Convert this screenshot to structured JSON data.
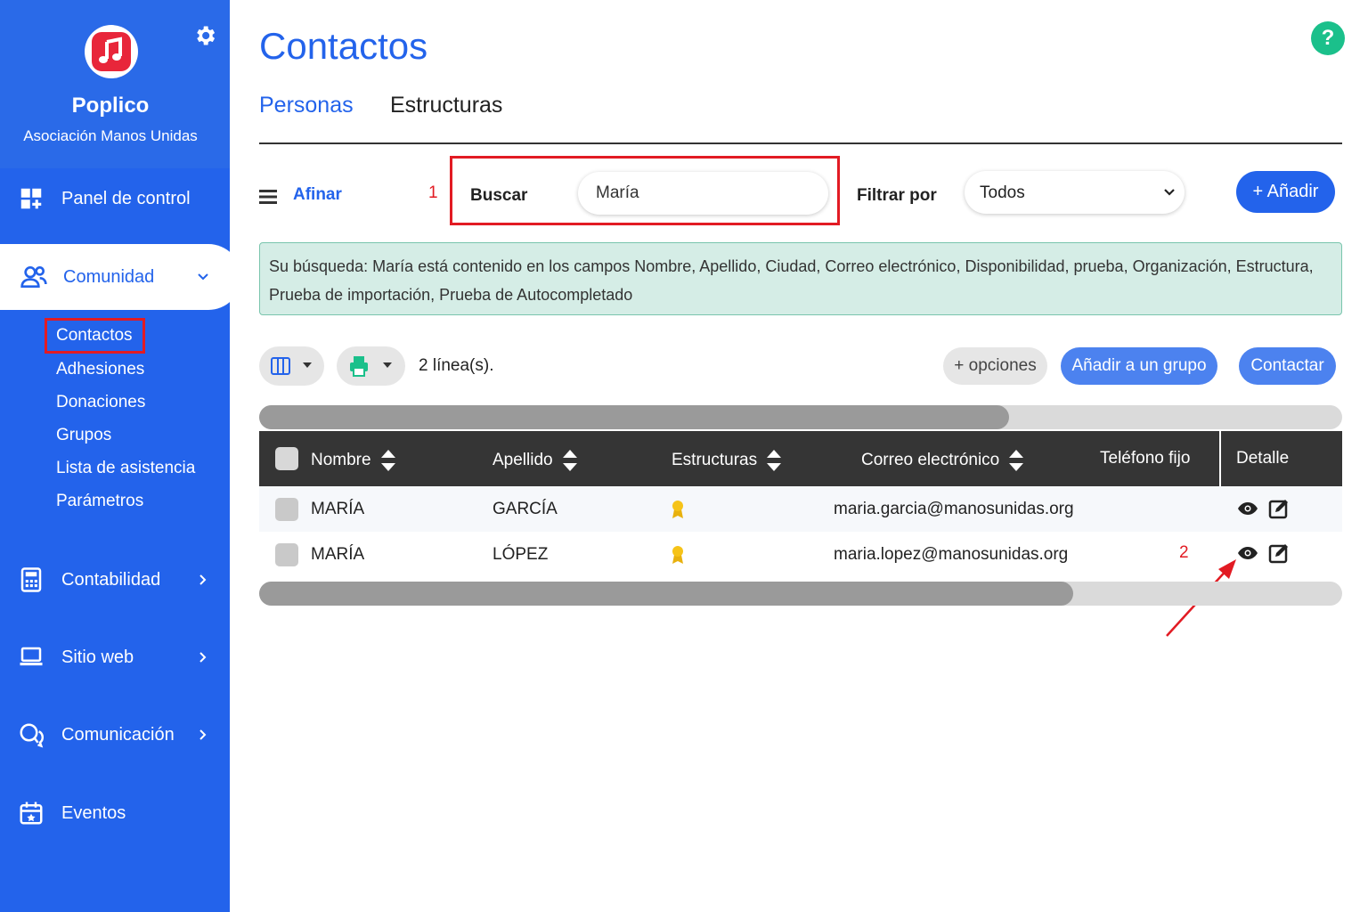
{
  "sidebar": {
    "app_name": "Poplico",
    "org_name": "Asociación Manos Unidas",
    "items": [
      {
        "label": "Panel de control"
      },
      {
        "label": "Comunidad"
      },
      {
        "label": "Contabilidad"
      },
      {
        "label": "Sitio web"
      },
      {
        "label": "Comunicación"
      },
      {
        "label": "Eventos"
      }
    ],
    "subitems": [
      {
        "label": "Contactos"
      },
      {
        "label": "Adhesiones"
      },
      {
        "label": "Donaciones"
      },
      {
        "label": "Grupos"
      },
      {
        "label": "Lista de asistencia"
      },
      {
        "label": "Parámetros"
      }
    ]
  },
  "header": {
    "title": "Contactos",
    "help": "?",
    "tabs": [
      {
        "label": "Personas"
      },
      {
        "label": "Estructuras"
      }
    ]
  },
  "toolbar": {
    "afinar": "Afinar",
    "annotation_1": "1",
    "search_label": "Buscar",
    "search_value": "María",
    "filter_label": "Filtrar por",
    "filter_value": "Todos",
    "add_label": "+ Añadir"
  },
  "info": {
    "text": "Su búsqueda: María está contenido en los campos Nombre, Apellido, Ciudad, Correo electrónico, Disponibilidad, prueba, Organización, Estructura, Prueba de importación, Prueba de Autocompletado"
  },
  "actions": {
    "lines": "2 línea(s).",
    "options": "+ opciones",
    "add_group": "Añadir a un grupo",
    "contact": "Contactar"
  },
  "table": {
    "columns": [
      "Nombre",
      "Apellido",
      "Estructuras",
      "Correo electrónico",
      "Teléfono fijo",
      "Detalle"
    ],
    "rows": [
      {
        "nombre": "MARÍA",
        "apellido": "GARCÍA",
        "correo": "maria.garcia@manosunidas.org",
        "telefono": ""
      },
      {
        "nombre": "MARÍA",
        "apellido": "LÓPEZ",
        "correo": "maria.lopez@manosunidas.org",
        "telefono": ""
      }
    ],
    "annotation_2": "2"
  },
  "colors": {
    "primary": "#2363eb",
    "accent_red": "#e21b23",
    "help_green": "#1bc08b",
    "info_bg": "#d5ede6",
    "header_dark": "#353535"
  },
  "icons": [
    "gear-icon",
    "dashboard-icon",
    "users-icon",
    "calculator-icon",
    "laptop-icon",
    "chat-icon",
    "calendar-icon",
    "menu-icon",
    "chevron-down-icon",
    "columns-icon",
    "printer-icon",
    "sort-icon",
    "ribbon-icon",
    "eye-icon",
    "edit-icon",
    "arrow-icon"
  ]
}
